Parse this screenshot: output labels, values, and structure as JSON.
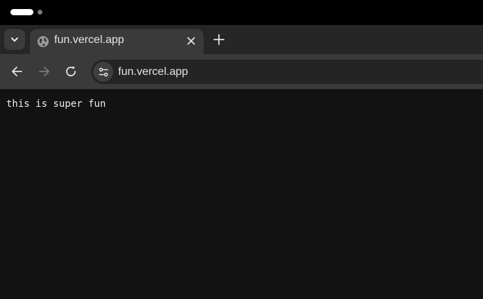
{
  "browser": {
    "tab": {
      "title": "fun.vercel.app",
      "favicon": "globe-icon"
    },
    "address_bar": {
      "url": "fun.vercel.app"
    },
    "icons": {
      "tab_search": "chevron-down-icon",
      "close_tab": "close-icon",
      "new_tab": "plus-icon",
      "back": "back-arrow-icon",
      "forward": "forward-arrow-icon",
      "reload": "reload-icon",
      "site_info": "tune-icon"
    },
    "forward_enabled": false
  },
  "page": {
    "body_text": "this is super fun"
  },
  "colors": {
    "status_bar": "#000000",
    "tab_strip": "#262626",
    "toolbar": "#3a3a3a",
    "omnibox": "#242424",
    "page_background": "#121212",
    "text": "#ededed"
  }
}
